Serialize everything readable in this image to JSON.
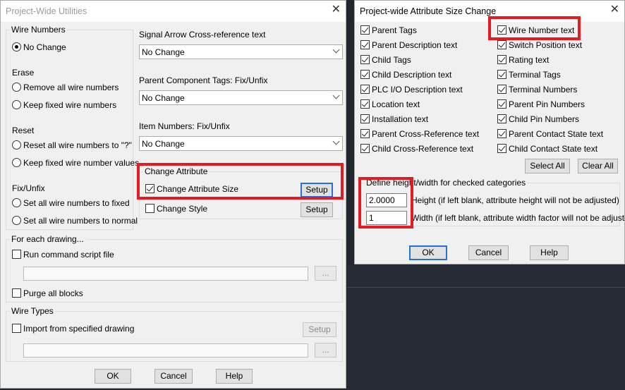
{
  "left_dialog": {
    "title": "Project-Wide Utilities",
    "wire_numbers": {
      "group_label": "Wire Numbers",
      "no_change": "No Change",
      "erase_label": "Erase",
      "remove_all": "Remove all wire numbers",
      "keep_fixed_1": "Keep fixed wire numbers",
      "reset_label": "Reset",
      "reset_all": "Reset all wire numbers to \"?\"",
      "keep_fixed_values": "Keep fixed wire number values",
      "fix_unfix_label": "Fix/Unfix",
      "set_fixed": "Set all wire numbers to fixed",
      "set_normal": "Set all wire numbers to normal"
    },
    "signal_arrow": {
      "label": "Signal Arrow Cross-reference text",
      "value": "No Change"
    },
    "parent_tags": {
      "label": "Parent Component Tags: Fix/Unfix",
      "value": "No Change"
    },
    "item_numbers": {
      "label": "Item Numbers: Fix/Unfix",
      "value": "No Change"
    },
    "change_attribute": {
      "group_label": "Change Attribute",
      "size_label": "Change Attribute Size",
      "size_checked": true,
      "style_label": "Change Style",
      "style_checked": false,
      "setup_label": "Setup"
    },
    "for_each_drawing": {
      "group_label": "For each drawing...",
      "run_script": "Run command script file",
      "browse": "...",
      "purge": "Purge all blocks"
    },
    "wire_types": {
      "group_label": "Wire Types",
      "import": "Import from specified drawing",
      "setup": "Setup",
      "browse": "..."
    },
    "buttons": {
      "ok": "OK",
      "cancel": "Cancel",
      "help": "Help"
    }
  },
  "right_dialog": {
    "title": "Project-wide Attribute Size Change",
    "left_checks": [
      "Parent Tags",
      "Parent Description text",
      "Child Tags",
      "Child Description text",
      "PLC I/O Description text",
      "Location text",
      "Installation text",
      "Parent Cross-Reference text",
      "Child Cross-Reference text"
    ],
    "right_checks": [
      "Wire Number text",
      "Switch Position text",
      "Rating text",
      "Terminal Tags",
      "Terminal Numbers",
      "Parent Pin Numbers",
      "Child Pin Numbers",
      "Parent Contact State text",
      "Child Contact State text"
    ],
    "select_all": "Select All",
    "clear_all": "Clear All",
    "define_label": "Define height/width for checked categories",
    "height_value": "2.0000",
    "height_label": "Height (if left blank, attribute height will not be adjusted)",
    "width_value": "1",
    "width_label": "Width (if left blank, attribute width factor will not be adjusted)",
    "buttons": {
      "ok": "OK",
      "cancel": "Cancel",
      "help": "Help"
    }
  },
  "colors": {
    "highlight": "#e41b23",
    "focus_border": "#2670d6",
    "cad_background": "#262b35"
  }
}
